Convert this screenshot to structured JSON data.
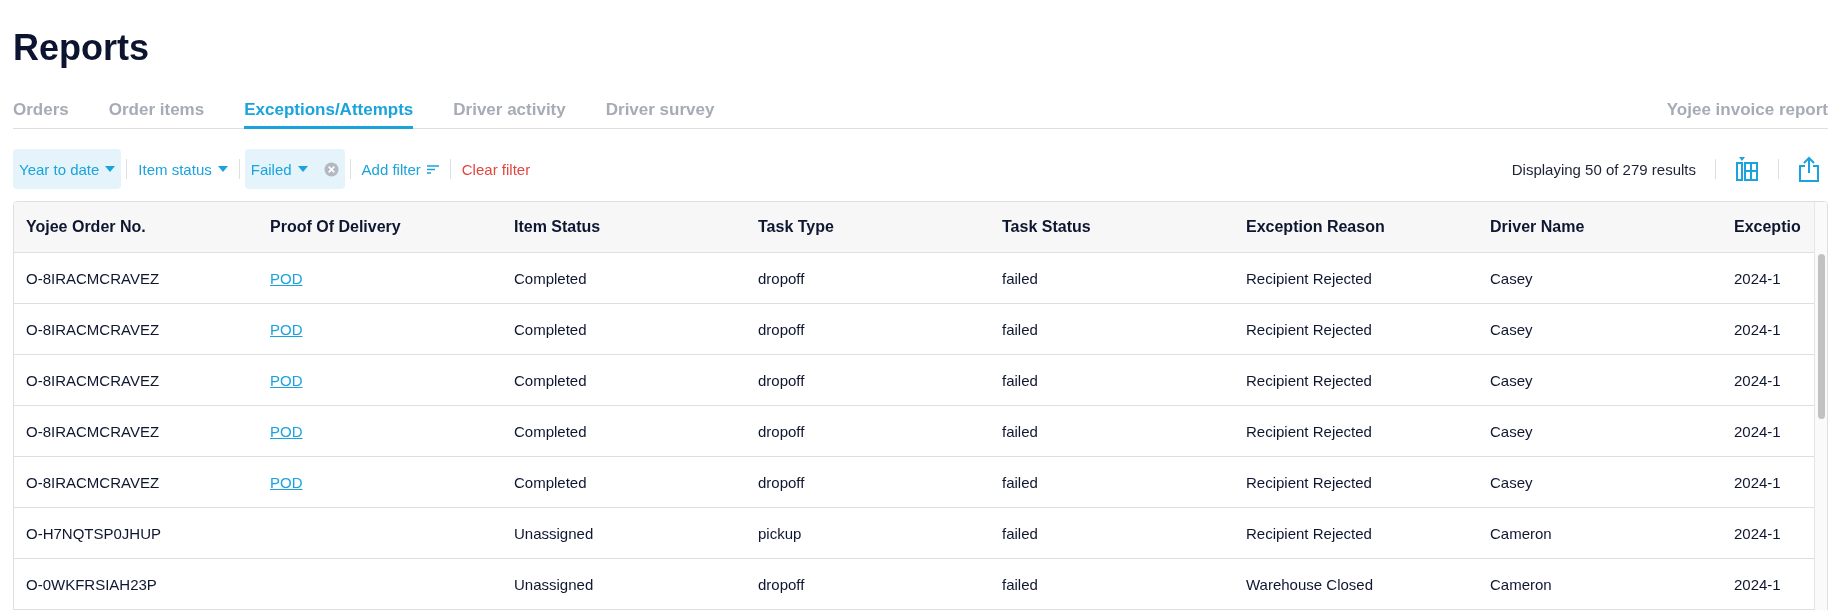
{
  "title": "Reports",
  "tabs": [
    {
      "label": "Orders",
      "selected": false
    },
    {
      "label": "Order items",
      "selected": false
    },
    {
      "label": "Exceptions/Attempts",
      "selected": true
    },
    {
      "label": "Driver activity",
      "selected": false
    },
    {
      "label": "Driver survey",
      "selected": false
    }
  ],
  "right_tab": {
    "label": "Yojee invoice report",
    "selected": false
  },
  "filters": [
    {
      "kind": "chip",
      "label": "Year to date",
      "clearable": false
    },
    {
      "kind": "plain",
      "label": "Item status",
      "clearable": false
    },
    {
      "kind": "chip",
      "label": "Failed",
      "clearable": true
    },
    {
      "kind": "add",
      "label": "Add filter"
    },
    {
      "kind": "clear",
      "label": "Clear filter"
    }
  ],
  "result_count": "Displaying 50 of 279 results",
  "table": {
    "columns": [
      "Yojee Order No.",
      "Proof Of Delivery",
      "Item Status",
      "Task Type",
      "Task Status",
      "Exception Reason",
      "Driver Name",
      "Exceptio"
    ],
    "rows": [
      [
        "O-8IRACMCRAVEZ",
        "POD",
        "Completed",
        "dropoff",
        "failed",
        "Recipient Rejected",
        "Casey",
        "2024-1"
      ],
      [
        "O-8IRACMCRAVEZ",
        "POD",
        "Completed",
        "dropoff",
        "failed",
        "Recipient Rejected",
        "Casey",
        "2024-1"
      ],
      [
        "O-8IRACMCRAVEZ",
        "POD",
        "Completed",
        "dropoff",
        "failed",
        "Recipient Rejected",
        "Casey",
        "2024-1"
      ],
      [
        "O-8IRACMCRAVEZ",
        "POD",
        "Completed",
        "dropoff",
        "failed",
        "Recipient Rejected",
        "Casey",
        "2024-1"
      ],
      [
        "O-8IRACMCRAVEZ",
        "POD",
        "Completed",
        "dropoff",
        "failed",
        "Recipient Rejected",
        "Casey",
        "2024-1"
      ],
      [
        "O-H7NQTSP0JHUP",
        "",
        "Unassigned",
        "pickup",
        "failed",
        "Recipient Rejected",
        "Cameron",
        "2024-1"
      ],
      [
        "O-0WKFRSIAH23P",
        "",
        "Unassigned",
        "dropoff",
        "failed",
        "Warehouse Closed",
        "Cameron",
        "2024-1"
      ]
    ]
  }
}
